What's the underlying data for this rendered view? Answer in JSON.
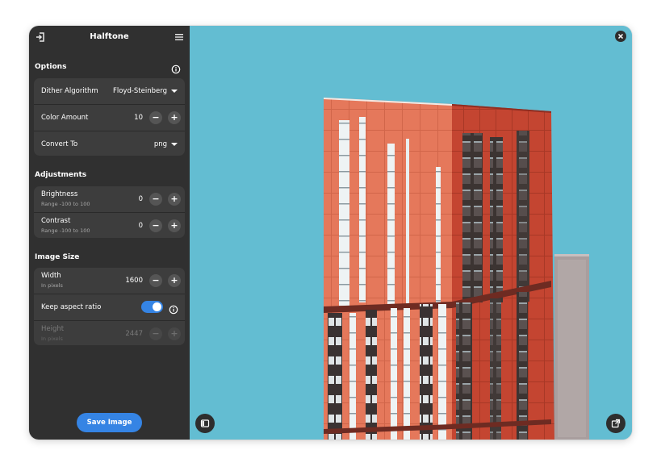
{
  "app": {
    "title": "Halftone"
  },
  "headerbar": {
    "open_icon": "open-file-icon",
    "menu_icon": "hamburger-menu-icon"
  },
  "options": {
    "title": "Options",
    "dither_algorithm": {
      "label": "Dither Algorithm",
      "value": "Floyd-Steinberg"
    },
    "color_amount": {
      "label": "Color Amount",
      "value": "10"
    },
    "convert_to": {
      "label": "Convert To",
      "value": "png"
    }
  },
  "adjustments": {
    "title": "Adjustments",
    "brightness": {
      "label": "Brightness",
      "sub": "Range -100 to 100",
      "value": "0"
    },
    "contrast": {
      "label": "Contrast",
      "sub": "Range -100 to 100",
      "value": "0"
    }
  },
  "image_size": {
    "title": "Image Size",
    "width": {
      "label": "Width",
      "sub": "In pixels",
      "value": "1600"
    },
    "keep_aspect": {
      "label": "Keep aspect ratio",
      "enabled": true
    },
    "height": {
      "label": "Height",
      "sub": "In pixels",
      "value": "2447"
    }
  },
  "save_button": "Save Image",
  "colors": {
    "accent": "#3584e4",
    "sidebar_bg": "#303030",
    "card_bg": "#3d3d3d",
    "sky": "#63bdd2",
    "facade_light": "#e5785b",
    "facade_dark": "#c44531"
  }
}
